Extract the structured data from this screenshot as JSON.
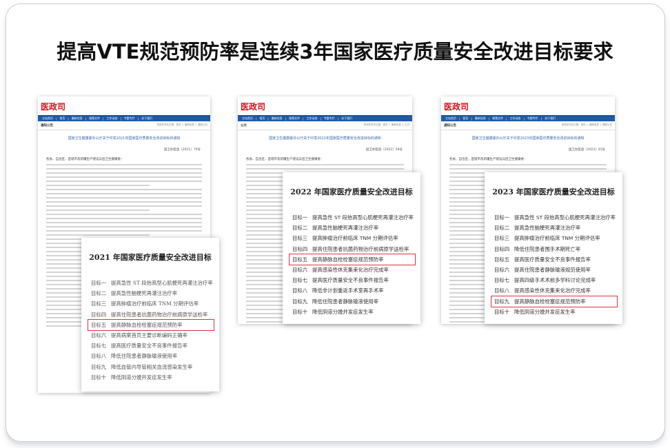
{
  "title": "提高VTE规范预防率是连续3年国家医疗质量安全改进目标要求",
  "nav": [
    "主站首页",
    "|",
    "首页",
    "|",
    "最新信息",
    "|",
    "政策文件",
    "|",
    "工作动态",
    "|",
    "专题专栏",
    "|",
    "关于我们"
  ],
  "docs": [
    {
      "logo": "医政司",
      "section": "通知公告",
      "crumb": "您现在所在位置：首页 > 最新信息 > 通知公告",
      "title": "国家卫生健康委办公厅关于印发2021年国家医疗质量安全改进目标的通知",
      "number": "国卫办医函〔2021〕76号",
      "salutation": "各省、自治区、直辖市及新疆生产建设兵团卫生健康委："
    },
    {
      "logo": "医政司",
      "section": "公文",
      "crumb": "您现在所在位置：首页 > 最新信息 > 公文",
      "title": "国家卫生健康委办公厅关于印发2022年国家医疗质量安全改进目标的通知",
      "number": "国卫办医函〔2022〕58号",
      "salutation": "各省、自治区、直辖市及新疆生产建设兵团卫生健康委："
    },
    {
      "logo": "医政司",
      "section": "通知公告",
      "crumb": "您现在所在位置：首页 > 最新信息 > 通知公告",
      "title": "国家卫生健康委办公厅关于印发2023年国家医疗质量安全改进目标的通知",
      "number": "国卫办医函〔2023〕45号",
      "salutation": "各省、自治区、直辖市及新疆生产建设兵团卫生健康委："
    }
  ],
  "cards": [
    {
      "title": "2021 年国家医疗质量安全改进目标",
      "highlight": 4,
      "items": [
        [
          "目标一",
          "提高急性 ST 段抬高型心肌梗死再灌注治疗率"
        ],
        [
          "目标二",
          "提高急性脑梗死再灌注治疗率"
        ],
        [
          "目标三",
          "提高肿瘤治疗前临床 TNM 分期评估率"
        ],
        [
          "目标四",
          "提高住院患者抗菌药物治疗前病原学送检率"
        ],
        [
          "目标五",
          "提高静脉血栓栓塞症规范预防率"
        ],
        [
          "目标六",
          "提高病案首页主要诊断编码正确率"
        ],
        [
          "目标七",
          "提高医疗质量安全不良事件报告率"
        ],
        [
          "目标八",
          "降低住院患者静脉输液使用率"
        ],
        [
          "目标九",
          "降低血管内导管相关血流感染发生率"
        ],
        [
          "目标十",
          "降低阴道分娩并发症发生率"
        ]
      ]
    },
    {
      "title": "2022 年国家医疗质量安全改进目标",
      "highlight": 4,
      "items": [
        [
          "目标一",
          "提高急性 ST 段抬高型心肌梗死再灌注治疗率"
        ],
        [
          "目标二",
          "提高急性脑梗死再灌注治疗率"
        ],
        [
          "目标三",
          "提高肿瘤治疗前临床 TNM 分期评估率"
        ],
        [
          "目标四",
          "提高住院患者抗菌药物治疗前病原学送检率"
        ],
        [
          "目标五",
          "提高静脉血栓栓塞症规范预防率"
        ],
        [
          "目标六",
          "提高感染性休克集束化治疗完成率"
        ],
        [
          "目标七",
          "提高医疗质量安全不良事件报告率"
        ],
        [
          "目标八",
          "降低非计划重返手术室再手术率"
        ],
        [
          "目标九",
          "降低住院患者静脉输液使用率"
        ],
        [
          "目标十",
          "降低阴道分娩并发症发生率"
        ]
      ]
    },
    {
      "title": "2023 年国家医疗质量安全改进目标",
      "highlight": 8,
      "items": [
        [
          "目标一",
          "提高急性 ST 段抬高型心肌梗死再灌注治疗率"
        ],
        [
          "目标二",
          "提高急性脑梗死再灌注治疗率"
        ],
        [
          "目标三",
          "提高肿瘤治疗前临床 TNM 分期评估率"
        ],
        [
          "目标四",
          "降低住院患者围手术期死亡率"
        ],
        [
          "目标五",
          "提高医疗质量安全不良事件报告率"
        ],
        [
          "目标六",
          "提高住院患者静脉输液规范使用率"
        ],
        [
          "目标七",
          "提高四级手术术前多学科讨论完成率"
        ],
        [
          "目标八",
          "提高感染性休克集束化治疗完成率"
        ],
        [
          "目标九",
          "提高静脉血栓栓塞症规范预防率"
        ],
        [
          "目标十",
          "降低阴道分娩并发症发生率"
        ]
      ]
    }
  ]
}
